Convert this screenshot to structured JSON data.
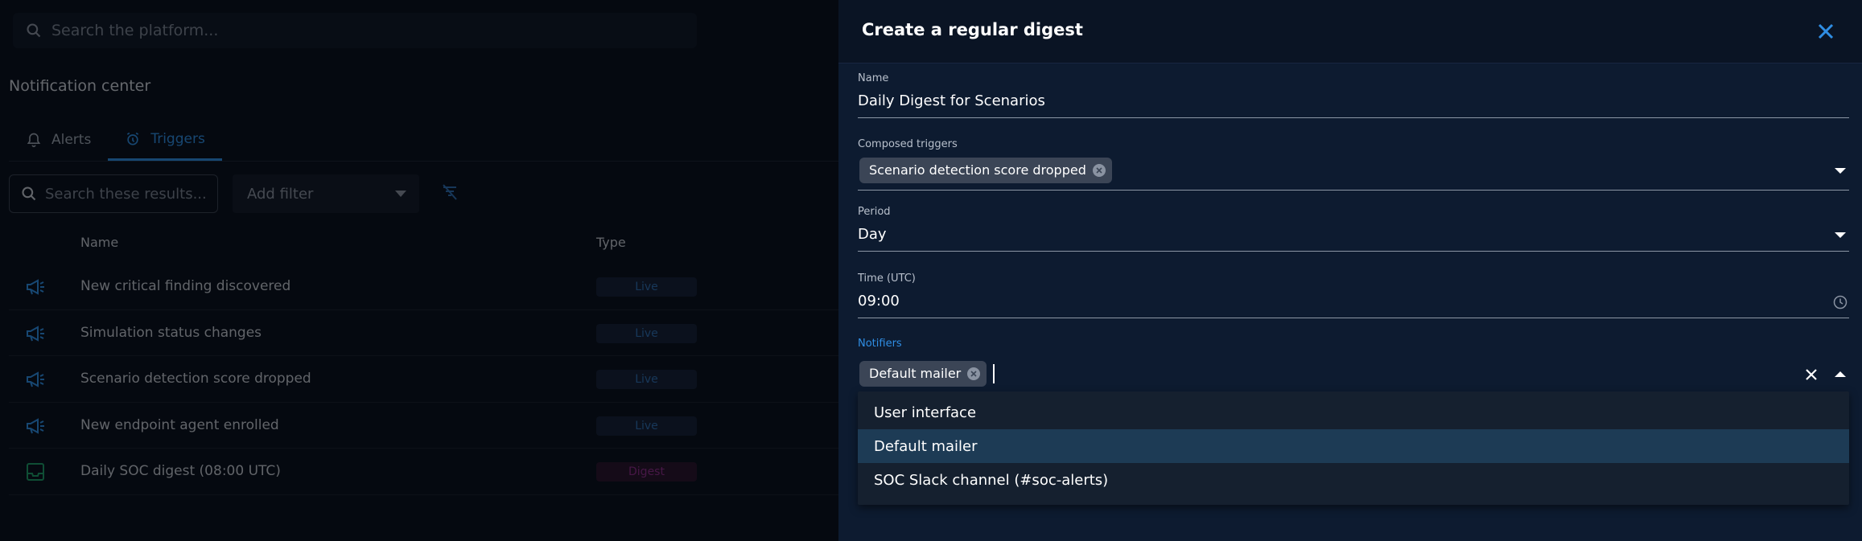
{
  "background": {
    "search_placeholder": "Search the platform...",
    "page_title": "Notification center",
    "tabs": [
      {
        "label": "Alerts",
        "icon": "bell-icon",
        "active": false
      },
      {
        "label": "Triggers",
        "icon": "alarm-icon",
        "active": true
      }
    ],
    "results_placeholder": "Search these results...",
    "add_filter": "Add filter",
    "columns": {
      "name": "Name",
      "type": "Type"
    },
    "rows": [
      {
        "icon": "megaphone-icon",
        "name": "New critical finding discovered",
        "type": "Live"
      },
      {
        "icon": "megaphone-icon",
        "name": "Simulation status changes",
        "type": "Live"
      },
      {
        "icon": "megaphone-icon",
        "name": "Scenario detection score dropped",
        "type": "Live"
      },
      {
        "icon": "megaphone-icon",
        "name": "New endpoint agent enrolled",
        "type": "Live"
      },
      {
        "icon": "inbox-icon",
        "name": "Daily SOC digest (08:00 UTC)",
        "type": "Digest"
      }
    ]
  },
  "drawer": {
    "title": "Create a regular digest",
    "name": {
      "label": "Name",
      "value": "Daily Digest for Scenarios"
    },
    "triggers": {
      "label": "Composed triggers",
      "chips": [
        "Scenario detection score dropped"
      ]
    },
    "period": {
      "label": "Period",
      "value": "Day"
    },
    "time": {
      "label": "Time (UTC)",
      "value": "09:00"
    },
    "notifiers": {
      "label": "Notifiers",
      "chips": [
        "Default mailer"
      ],
      "options": [
        {
          "label": "User interface",
          "selected": false
        },
        {
          "label": "Default mailer",
          "selected": true
        },
        {
          "label": "SOC Slack channel (#soc-alerts)",
          "selected": false
        }
      ]
    }
  },
  "colors": {
    "accent": "#2f8ee4",
    "drawer_bg": "#0d1b30",
    "option_selected": "#1d3b55",
    "live_badge": "#2f6fb3",
    "digest_badge": "#8d2f8c",
    "inbox_icon": "#1f9d6a"
  }
}
